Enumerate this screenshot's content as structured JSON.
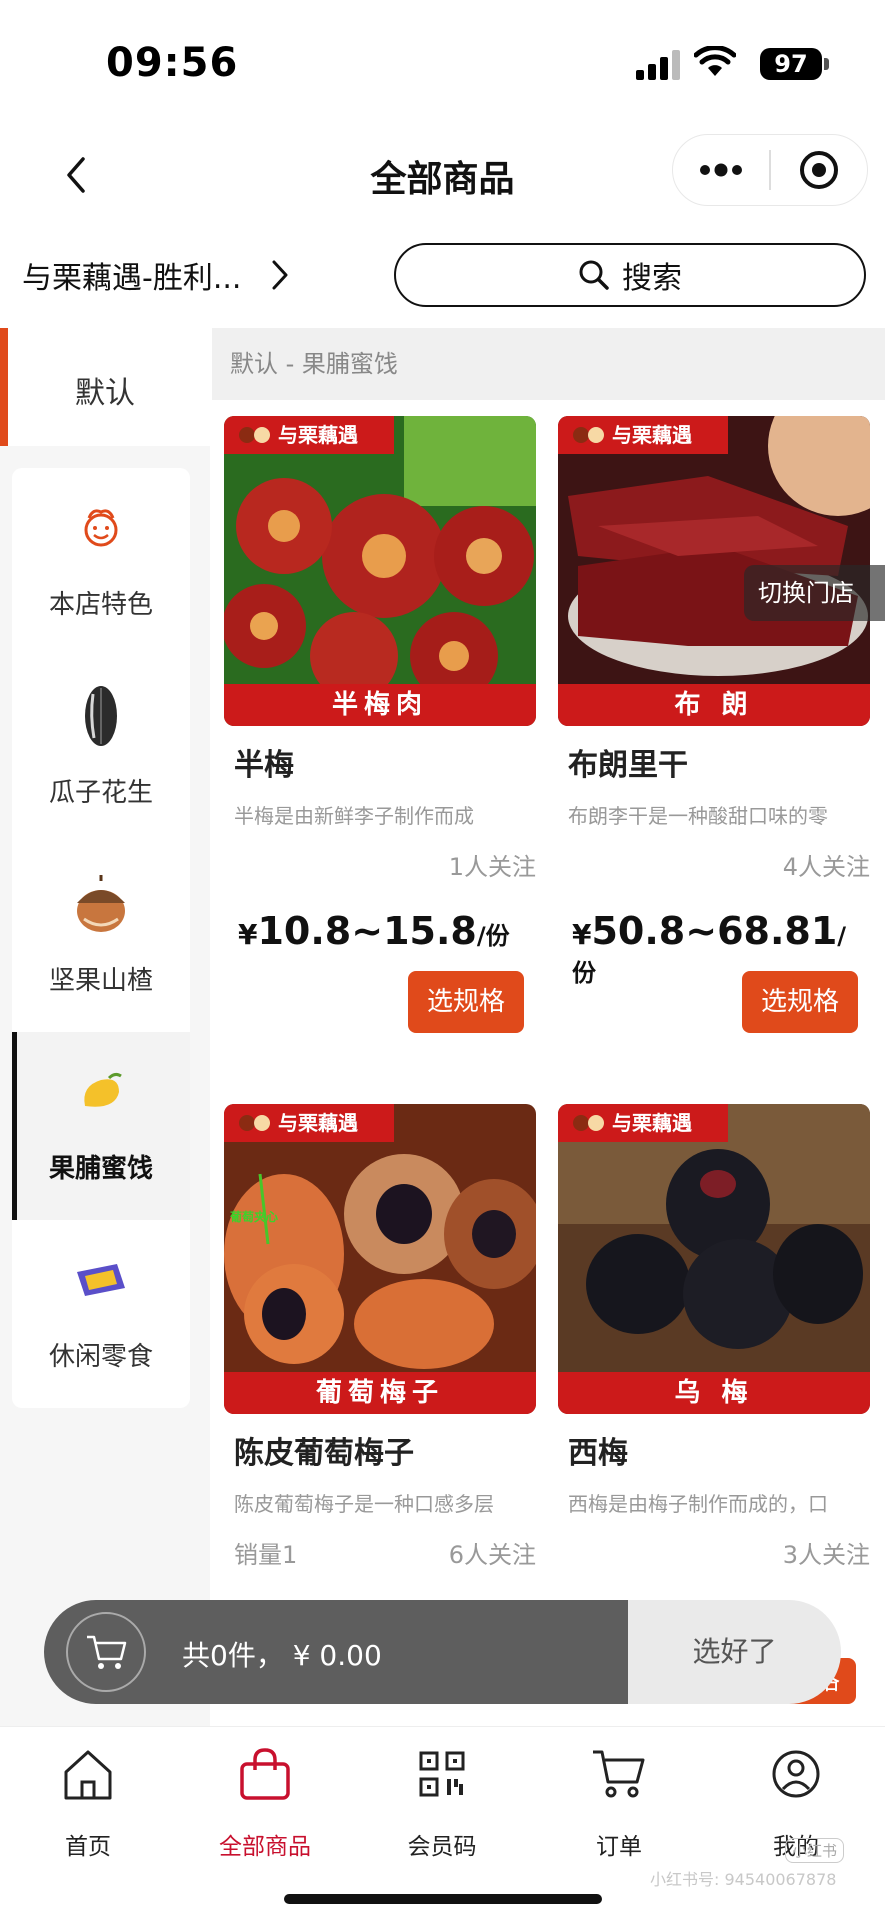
{
  "status": {
    "time": "09:56",
    "battery": "97"
  },
  "nav": {
    "title": "全部商品"
  },
  "store": {
    "name": "与栗藕遇-胜利..."
  },
  "search": {
    "label": "搜索"
  },
  "sidebar": {
    "default_label": "默认",
    "items": [
      {
        "label": "本店特色",
        "icon": "smiley-chef-icon"
      },
      {
        "label": "瓜子花生",
        "icon": "sunflower-seed-icon"
      },
      {
        "label": "坚果山楂",
        "icon": "hazelnut-icon"
      },
      {
        "label": "果脯蜜饯",
        "icon": "mango-icon",
        "active": true
      },
      {
        "label": "休闲零食",
        "icon": "snack-bag-icon"
      }
    ]
  },
  "breadcrumb": "默认 - 果脯蜜饯",
  "brand_tag": "与栗藕遇",
  "products": [
    {
      "banner": "半梅肉",
      "name": "半梅",
      "desc": "半梅是由新鲜李子制作而成",
      "sales": "",
      "follows": "1人关注",
      "price_cur": "¥",
      "price": "10.8~15.8",
      "unit": "/份",
      "button": "选规格"
    },
    {
      "banner": "布  朗",
      "name": "布朗里干",
      "desc": "布朗李干是一种酸甜口味的零",
      "sales": "",
      "follows": "4人关注",
      "price_cur": "¥",
      "price": "50.8~68.81",
      "unit": "/份",
      "button": "选规格"
    },
    {
      "banner": "葡萄梅子",
      "name": "陈皮葡萄梅子",
      "desc": "陈皮葡萄梅子是一种口感多层",
      "sales": "销量1",
      "follows": "6人关注",
      "inner_label": "葡萄夹心"
    },
    {
      "banner": "乌  梅",
      "name": "西梅",
      "desc": "西梅是由梅子制作而成的，口",
      "sales": "",
      "follows": "3人关注"
    }
  ],
  "switch_store": "切换门店",
  "cart": {
    "summary": "共0件，  ¥ 0.00",
    "confirm": "选好了",
    "partial_btn": "格"
  },
  "tabs": [
    {
      "label": "首页",
      "icon": "home-icon"
    },
    {
      "label": "全部商品",
      "icon": "shopping-bag-icon",
      "active": true
    },
    {
      "label": "会员码",
      "icon": "qr-code-icon"
    },
    {
      "label": "订单",
      "icon": "cart-icon"
    },
    {
      "label": "我的",
      "icon": "user-icon"
    }
  ],
  "watermark": "小红书号: 9454006787​8",
  "mini_badge": "小红书",
  "colors": {
    "accent": "#e04a1b",
    "brand_red": "#cc1a1a",
    "tab_active": "#c8102e"
  }
}
